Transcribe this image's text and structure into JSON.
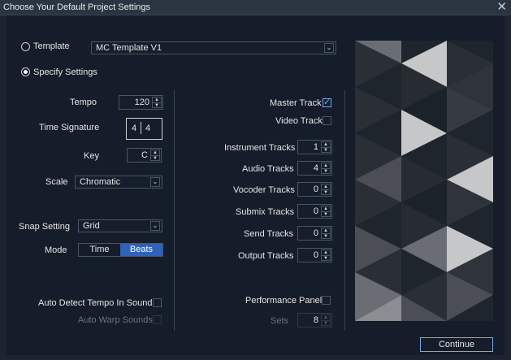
{
  "window": {
    "title": "Choose Your Default Project Settings",
    "close": "✕"
  },
  "template": {
    "label": "Template",
    "selected": false,
    "value": "MC Template V1"
  },
  "specify": {
    "label": "Specify Settings",
    "selected": true
  },
  "tempo": {
    "label": "Tempo",
    "value": "120"
  },
  "time_signature": {
    "label": "Time Signature",
    "numerator": "4",
    "denominator": "4"
  },
  "key": {
    "label": "Key",
    "value": "C"
  },
  "scale": {
    "label": "Scale",
    "value": "Chromatic"
  },
  "snap": {
    "label": "Snap Setting",
    "value": "Grid"
  },
  "mode": {
    "label": "Mode",
    "options": [
      "Time",
      "Beats"
    ],
    "selected": "Beats"
  },
  "auto_detect": {
    "label": "Auto Detect Tempo In Sounds",
    "checked": false
  },
  "auto_warp": {
    "label": "Auto Warp Sounds",
    "checked": false,
    "disabled": true
  },
  "master_track": {
    "label": "Master Track",
    "checked": true
  },
  "video_track": {
    "label": "Video Track",
    "checked": false
  },
  "tracks": [
    {
      "label": "Instrument Tracks",
      "value": "1"
    },
    {
      "label": "Audio Tracks",
      "value": "4"
    },
    {
      "label": "Vocoder Tracks",
      "value": "0"
    },
    {
      "label": "Submix Tracks",
      "value": "0"
    },
    {
      "label": "Send Tracks",
      "value": "0"
    },
    {
      "label": "Output Tracks",
      "value": "0"
    }
  ],
  "performance_panel": {
    "label": "Performance Panel",
    "checked": false
  },
  "sets": {
    "label": "Sets",
    "value": "8",
    "disabled": true
  },
  "continue_button": {
    "label": "Continue"
  },
  "colors": {
    "accent": "#2f62b8",
    "background": "#141d29",
    "check": "#7aa7e6"
  },
  "icons": {
    "dropdown": "chevron-down-icon",
    "spinner": "spinner-arrows-icon",
    "close": "close-icon",
    "check": "checkmark-icon"
  }
}
